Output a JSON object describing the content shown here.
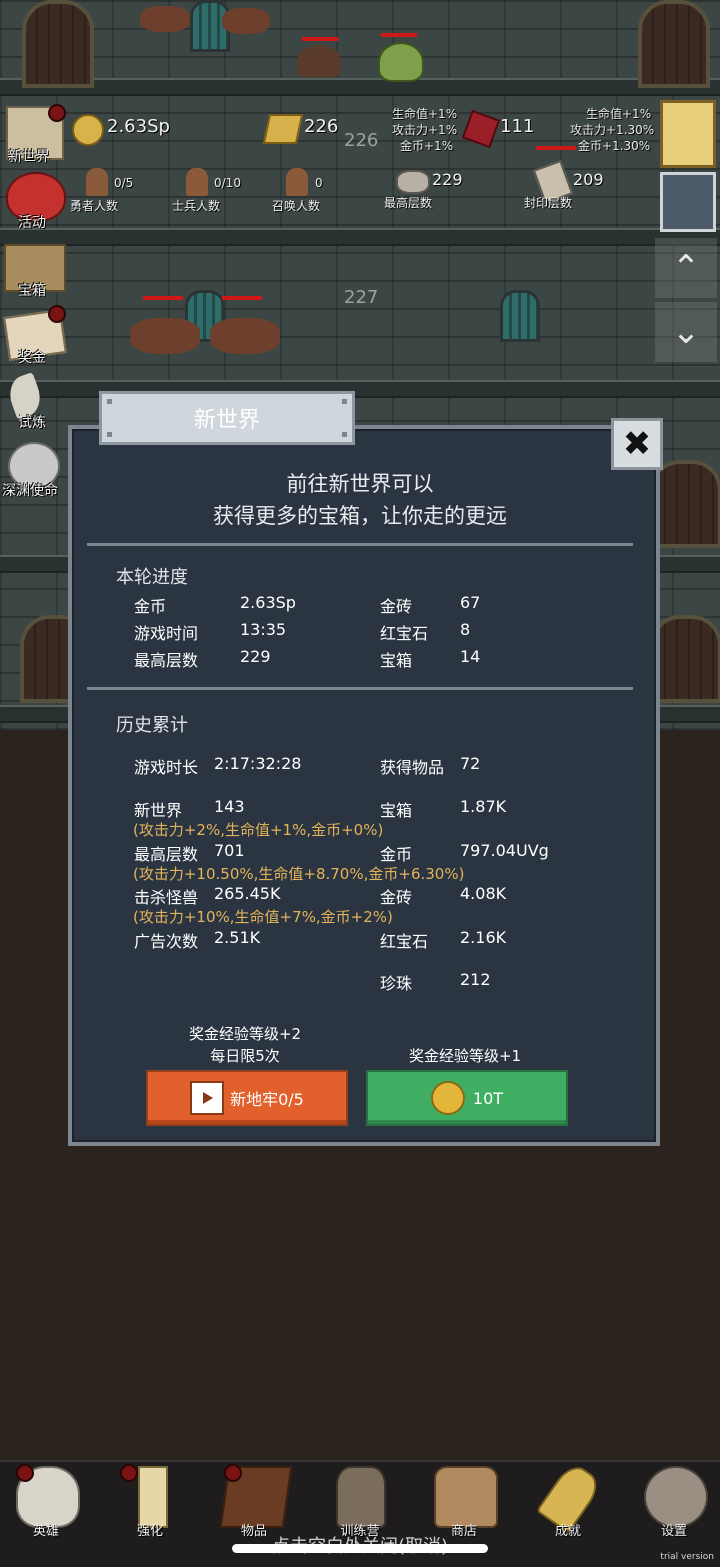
{
  "hud": {
    "gold": "2.63Sp",
    "gold_bar": "226",
    "ruby": "111",
    "bonus_left": [
      "生命值+1%",
      "攻击力+1%",
      "金币+1%"
    ],
    "bonus_right": [
      "生命值+1%",
      "攻击力+1.30%",
      "金币+1.30%"
    ],
    "heroes_value": "0/5",
    "heroes_label": "勇者人数",
    "soldiers_value": "0/10",
    "soldiers_label": "士兵人数",
    "summons_value": "0",
    "summons_label": "召唤人数",
    "max_floor_value": "229",
    "max_floor_label": "最高层数",
    "sealed_value": "209",
    "sealed_label": "封印层数"
  },
  "floors": [
    "226",
    "227"
  ],
  "side_menu": [
    "新世界",
    "活动",
    "宝箱",
    "奖金",
    "试炼",
    "深渊使命"
  ],
  "dialog": {
    "tab_title": "新世界",
    "close_label": "✖",
    "headline_1": "前往新世界可以",
    "headline_2": "获得更多的宝箱，让你走的更远",
    "round": {
      "title": "本轮进度",
      "rows": [
        {
          "k1": "金币",
          "v1": "2.63Sp",
          "k2": "金砖",
          "v2": "67"
        },
        {
          "k1": "游戏时间",
          "v1": "13:35",
          "k2": "红宝石",
          "v2": "8"
        },
        {
          "k1": "最高层数",
          "v1": "229",
          "k2": "宝箱",
          "v2": "14"
        }
      ]
    },
    "history": {
      "title": "历史累计",
      "playtime_label": "游戏时长",
      "playtime": "2:17:32:28",
      "items_label": "获得物品",
      "items": "72",
      "newworld_label": "新世界",
      "newworld": "143",
      "chest_label": "宝箱",
      "chest": "1.87K",
      "bonus_1": "(攻击力+2%,生命值+1%,金币+0%)",
      "maxfloor_label": "最高层数",
      "maxfloor": "701",
      "gold_label": "金币",
      "gold": "797.04UVg",
      "bonus_2": "(攻击力+10.50%,生命值+8.70%,金币+6.30%)",
      "kills_label": "击杀怪兽",
      "kills": "265.45K",
      "bricks_label": "金砖",
      "bricks": "4.08K",
      "bonus_3": "(攻击力+10%,生命值+7%,金币+2%)",
      "ads_label": "广告次数",
      "ads": "2.51K",
      "ruby_label": "红宝石",
      "ruby": "2.16K",
      "pearl_label": "珍珠",
      "pearl": "212"
    },
    "left_note_1": "奖金经验等级+2",
    "left_note_2": "每日限5次",
    "right_note": "奖金经验等级+1",
    "btn_ad": "新地牢0/5",
    "btn_pay": "10T"
  },
  "nav": [
    "英雄",
    "强化",
    "物品",
    "训练营",
    "商店",
    "成就",
    "设置"
  ],
  "hint": "点击空白处关闭(取消)",
  "watermark": "trial version",
  "colors": {
    "orange": "#e2602b",
    "green": "#3fae63",
    "bonus": "#e2b35a",
    "panel": "#2b3541"
  }
}
